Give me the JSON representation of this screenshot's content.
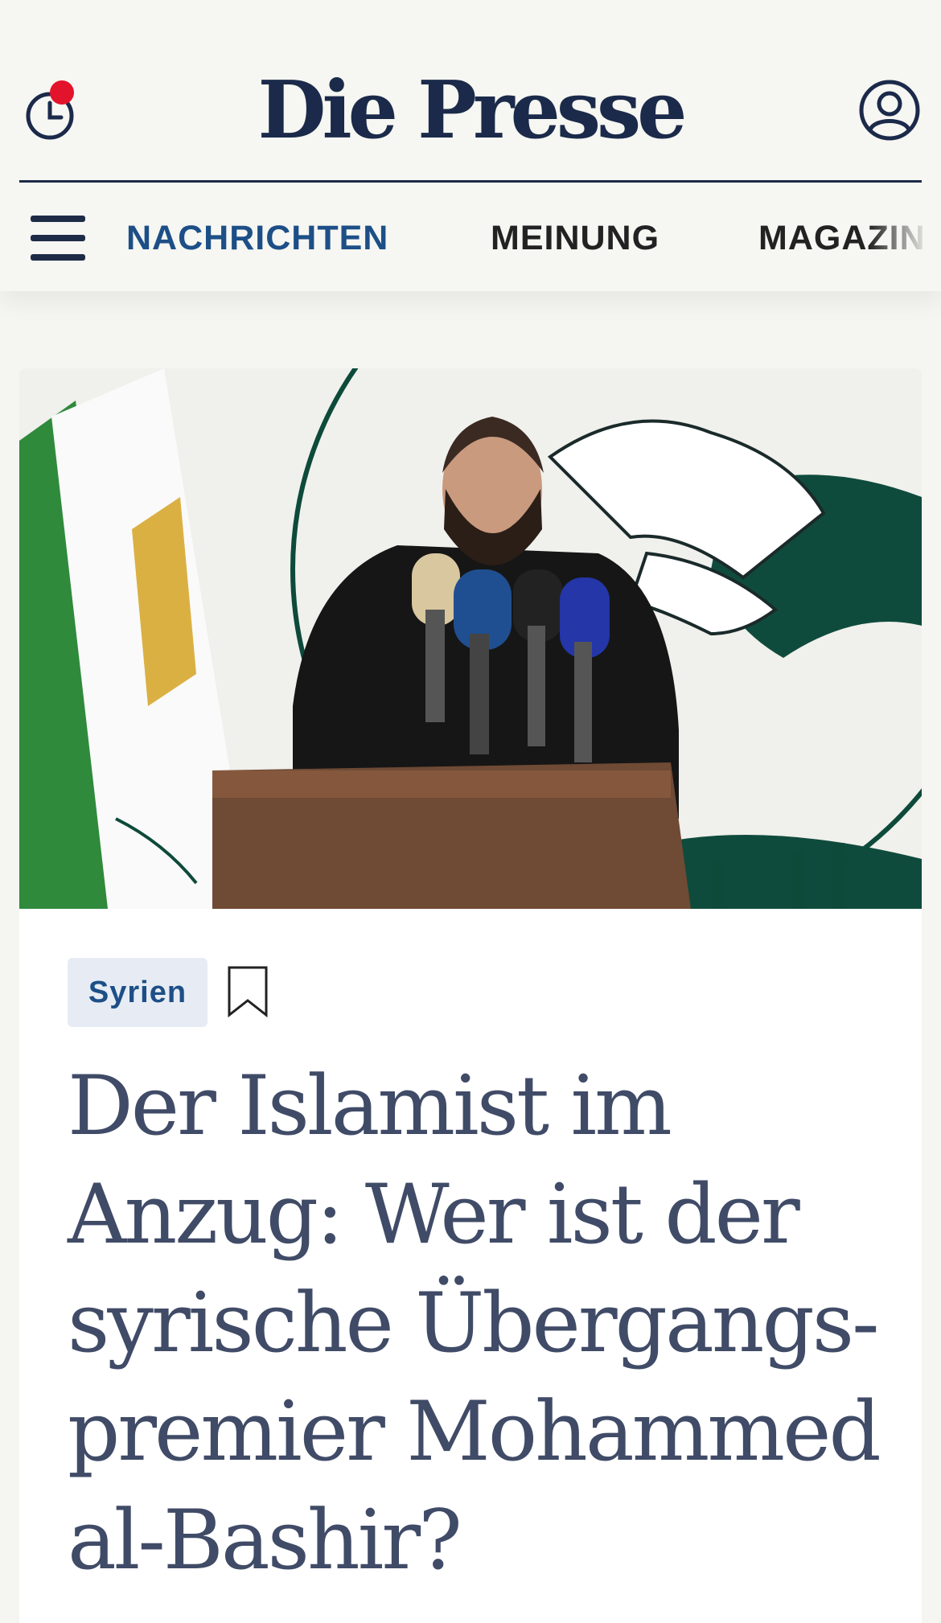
{
  "header": {
    "logo": "Die Presse",
    "history_icon": "clock-history-icon",
    "account_icon": "user-account-icon",
    "notification": "red-dot"
  },
  "nav": {
    "menu_icon": "hamburger-menu-icon",
    "items": [
      {
        "label": "NACHRICHTEN",
        "active": true
      },
      {
        "label": "MEINUNG",
        "active": false
      },
      {
        "label": "MAGAZIN",
        "active": false
      }
    ]
  },
  "article": {
    "image_alt": "Mohammed al-Bashir am Rednerpult mit Mikrofonen",
    "tag": "Syrien",
    "bookmark_icon": "bookmark-icon",
    "headline": "Der Islamist im Anzug: Wer ist der syrische Übergangs-premier Mohammed al-Bashir?"
  },
  "colors": {
    "brand": "#1b2a4a",
    "nav_active": "#1d4f87",
    "notification": "#e3132c",
    "headline": "#404b67",
    "tag_bg": "#e7ecf4"
  }
}
